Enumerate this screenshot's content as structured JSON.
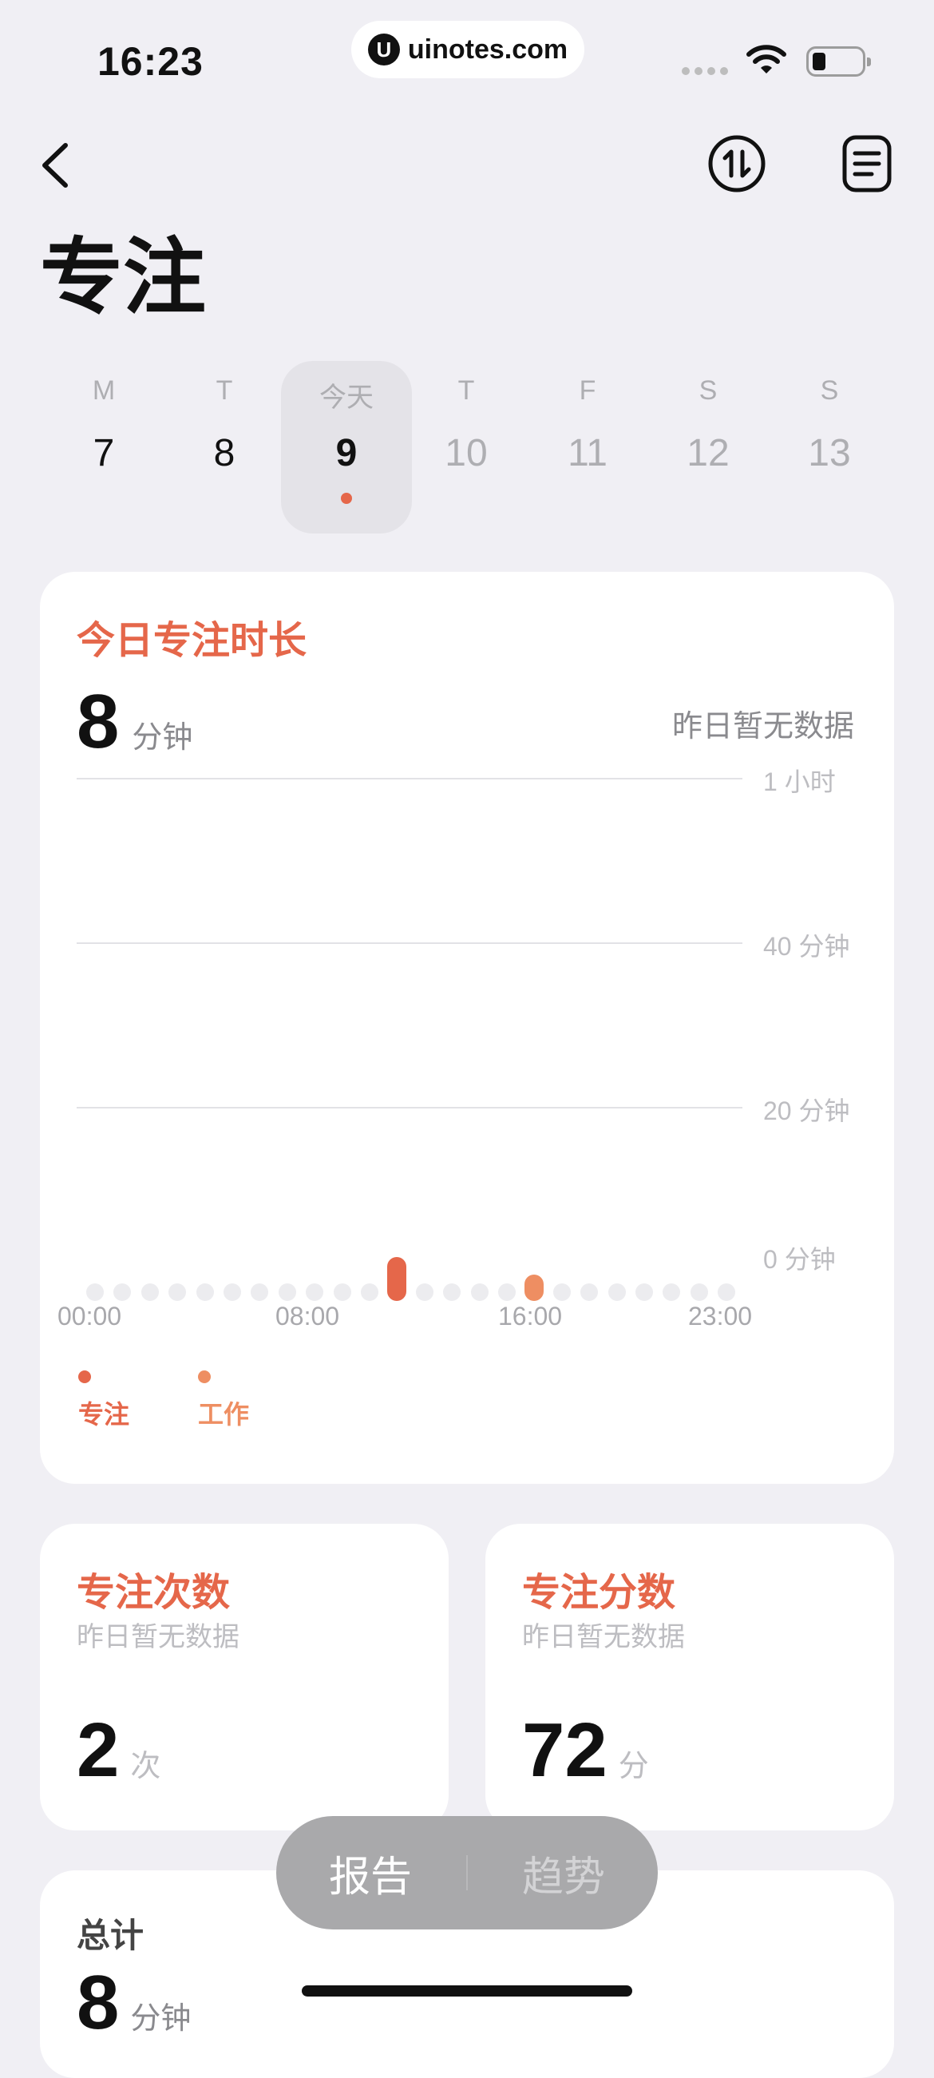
{
  "status_bar": {
    "time": "16:23",
    "url": "uinotes.com",
    "url_logo": "U"
  },
  "header": {
    "back_icon": "chevron-left-icon",
    "sort_icon": "sort-arrows-icon",
    "list_icon": "document-list-icon"
  },
  "page_title": "专注",
  "week": [
    {
      "weekday": "M",
      "date": "7"
    },
    {
      "weekday": "T",
      "date": "8"
    },
    {
      "weekday": "今天",
      "date": "9"
    },
    {
      "weekday": "T",
      "date": "10"
    },
    {
      "weekday": "F",
      "date": "11"
    },
    {
      "weekday": "S",
      "date": "12"
    },
    {
      "weekday": "S",
      "date": "13"
    }
  ],
  "focus_card": {
    "title": "今日专注时长",
    "value": "8",
    "unit": "分钟",
    "compare": "昨日暂无数据",
    "y_labels": [
      "1 小时",
      "40 分钟",
      "20 分钟",
      "0 分钟"
    ],
    "x_labels": [
      "00:00",
      "08:00",
      "16:00",
      "23:00"
    ],
    "legend": [
      "专注",
      "工作"
    ]
  },
  "chart_data": {
    "type": "bar",
    "categories": [
      "00:00",
      "01:00",
      "02:00",
      "03:00",
      "04:00",
      "05:00",
      "06:00",
      "07:00",
      "08:00",
      "09:00",
      "10:00",
      "11:00",
      "12:00",
      "13:00",
      "14:00",
      "15:00",
      "16:00",
      "17:00",
      "18:00",
      "19:00",
      "20:00",
      "21:00",
      "22:00",
      "23:00"
    ],
    "series": [
      {
        "name": "专注",
        "color": "#E5674A",
        "values": [
          0,
          0,
          0,
          0,
          0,
          0,
          0,
          0,
          0,
          0,
          0,
          5,
          0,
          0,
          0,
          0,
          0,
          0,
          0,
          0,
          0,
          0,
          0,
          0
        ]
      },
      {
        "name": "工作",
        "color": "#EE8E62",
        "values": [
          0,
          0,
          0,
          0,
          0,
          0,
          0,
          0,
          0,
          0,
          0,
          0,
          0,
          0,
          0,
          0,
          3,
          0,
          0,
          0,
          0,
          0,
          0,
          0
        ]
      }
    ],
    "ylim": [
      0,
      60
    ],
    "y_ticks": [
      "0 分钟",
      "20 分钟",
      "40 分钟",
      "1 小时"
    ],
    "grid": true,
    "legend_position": "bottom-left"
  },
  "count_card": {
    "title": "专注次数",
    "compare": "昨日暂无数据",
    "value": "2",
    "unit": "次"
  },
  "score_card": {
    "title": "专注分数",
    "compare": "昨日暂无数据",
    "value": "72",
    "unit": "分"
  },
  "total_card": {
    "title": "总计",
    "value": "8",
    "unit": "分钟"
  },
  "tabs": {
    "report": "报告",
    "trend": "趋势"
  },
  "colors": {
    "accent": "#E5674A",
    "accent_light": "#EE8E62",
    "background": "#F0EFF4"
  }
}
